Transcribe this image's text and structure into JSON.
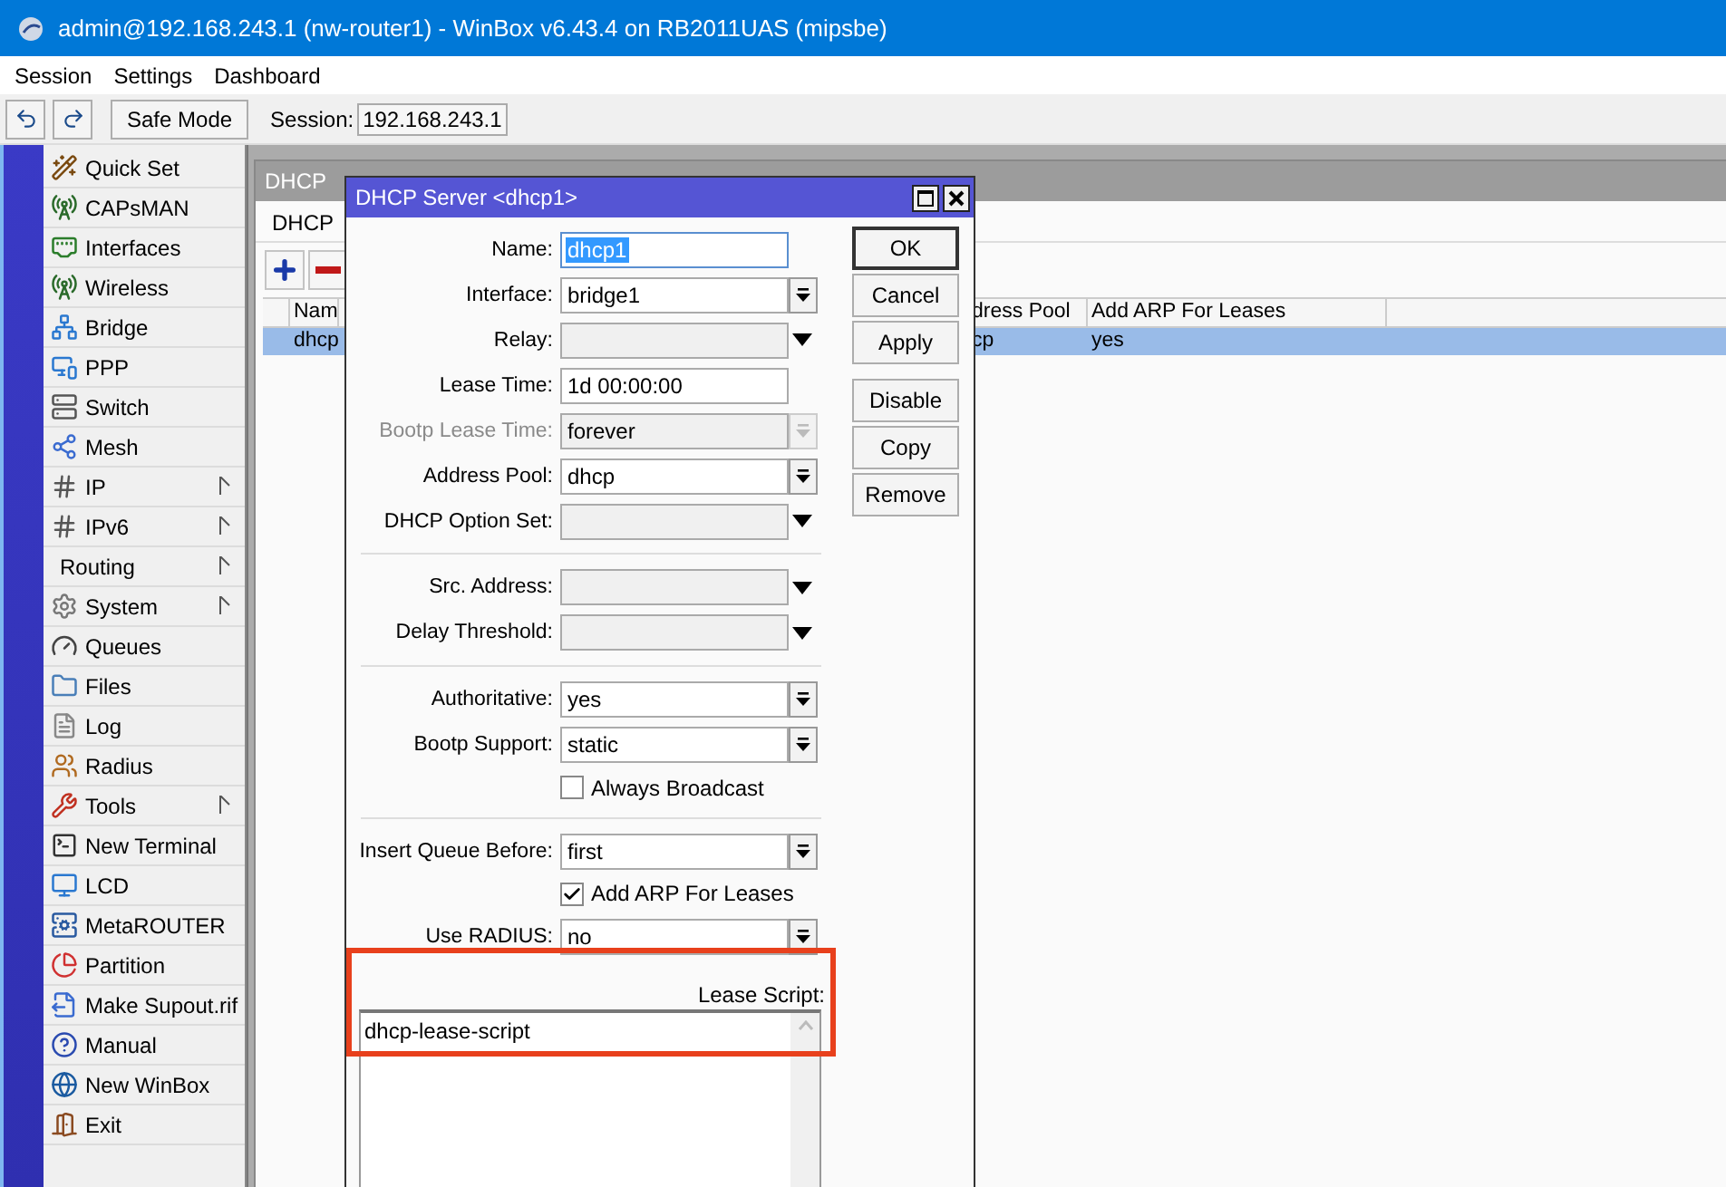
{
  "window": {
    "title": "admin@192.168.243.1 (nw-router1) - WinBox v6.43.4 on RB2011UAS (mipsbe)"
  },
  "menu": [
    "Session",
    "Settings",
    "Dashboard"
  ],
  "toolbar": {
    "safe_mode": "Safe Mode",
    "session_label": "Session:",
    "session_value": "192.168.243.1"
  },
  "sidebar": {
    "items": [
      {
        "label": "Quick Set",
        "submenu": false
      },
      {
        "label": "CAPsMAN",
        "submenu": false
      },
      {
        "label": "Interfaces",
        "submenu": false
      },
      {
        "label": "Wireless",
        "submenu": false
      },
      {
        "label": "Bridge",
        "submenu": false
      },
      {
        "label": "PPP",
        "submenu": false
      },
      {
        "label": "Switch",
        "submenu": false
      },
      {
        "label": "Mesh",
        "submenu": false
      },
      {
        "label": "IP",
        "submenu": true
      },
      {
        "label": "IPv6",
        "submenu": true
      },
      {
        "label": "Routing",
        "submenu": true
      },
      {
        "label": "System",
        "submenu": true
      },
      {
        "label": "Queues",
        "submenu": false
      },
      {
        "label": "Files",
        "submenu": false
      },
      {
        "label": "Log",
        "submenu": false
      },
      {
        "label": "Radius",
        "submenu": false
      },
      {
        "label": "Tools",
        "submenu": true
      },
      {
        "label": "New Terminal",
        "submenu": false
      },
      {
        "label": "LCD",
        "submenu": false
      },
      {
        "label": "MetaROUTER",
        "submenu": false
      },
      {
        "label": "Partition",
        "submenu": false
      },
      {
        "label": "Make Supout.rif",
        "submenu": false
      },
      {
        "label": "Manual",
        "submenu": false
      },
      {
        "label": "New WinBox",
        "submenu": false
      },
      {
        "label": "Exit",
        "submenu": false
      }
    ]
  },
  "list_window": {
    "title": "DHCP",
    "tabs": [
      {
        "label": "DHCP",
        "selected": true
      }
    ],
    "table": {
      "columns": [
        "Nam",
        "dress Pool",
        "Add ARP For Leases"
      ],
      "rows": [
        {
          "selected": true,
          "cells": [
            "dhcp",
            "cp",
            "yes"
          ]
        }
      ]
    }
  },
  "dialog": {
    "title": "DHCP Server <dhcp1>",
    "groups": [
      {
        "rows": [
          {
            "kind": "text",
            "label": "Name:",
            "value": "dhcp1",
            "disabled": false,
            "highlighted": true
          },
          {
            "kind": "select",
            "label": "Interface:",
            "value": "bridge1",
            "disabled": false,
            "highlighted": false
          },
          {
            "kind": "combo",
            "label": "Relay:",
            "disabled": false
          },
          {
            "kind": "text",
            "label": "Lease Time:",
            "value": "1d 00:00:00",
            "disabled": false,
            "highlighted": false
          },
          {
            "kind": "select",
            "label": "Bootp Lease Time:",
            "value": "forever",
            "disabled": true,
            "highlighted": false
          },
          {
            "kind": "select",
            "label": "Address Pool:",
            "value": "dhcp",
            "disabled": false,
            "highlighted": false
          },
          {
            "kind": "combo",
            "label": "DHCP Option Set:",
            "disabled": false
          }
        ]
      },
      {
        "rows": [
          {
            "kind": "combo",
            "label": "Src. Address:",
            "disabled": false
          },
          {
            "kind": "combo",
            "label": "Delay Threshold:",
            "disabled": false
          }
        ]
      },
      {
        "rows": [
          {
            "kind": "select",
            "label": "Authoritative:",
            "value": "yes",
            "disabled": false,
            "highlighted": false
          },
          {
            "kind": "select",
            "label": "Bootp Support:",
            "value": "static",
            "disabled": false,
            "highlighted": false
          },
          {
            "kind": "checkbox",
            "label": "Always Broadcast",
            "checked": false
          }
        ]
      },
      {
        "rows": [
          {
            "kind": "select",
            "label": "Insert Queue Before:",
            "value": "first",
            "disabled": false,
            "highlighted": false
          },
          {
            "kind": "checkbox",
            "label": "Add ARP For Leases",
            "checked": true
          },
          {
            "kind": "select",
            "label": "Use RADIUS:",
            "value": "no",
            "disabled": false,
            "highlighted": false
          }
        ]
      }
    ],
    "script": {
      "label": "Lease Script:",
      "value": "dhcp-lease-script"
    },
    "button_groups": [
      [
        {
          "label": "OK",
          "default": true
        },
        {
          "label": "Cancel",
          "default": false
        },
        {
          "label": "Apply",
          "default": false
        }
      ],
      [
        {
          "label": "Disable",
          "default": false
        },
        {
          "label": "Copy",
          "default": false
        },
        {
          "label": "Remove",
          "default": false
        }
      ]
    ]
  }
}
